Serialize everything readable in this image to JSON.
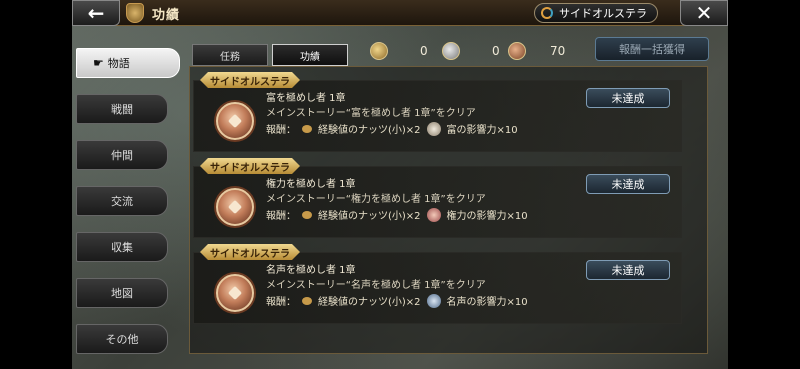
{
  "header": {
    "back_icon": "←",
    "title": "功績",
    "side_orsterra_label": "サイドオルステラ",
    "close_icon": "✕"
  },
  "nav": {
    "items": [
      {
        "label": "物語",
        "active": true
      },
      {
        "label": "戦闘"
      },
      {
        "label": "仲間"
      },
      {
        "label": "交流"
      },
      {
        "label": "収集"
      },
      {
        "label": "地図"
      },
      {
        "label": "その他"
      }
    ]
  },
  "tabs": [
    {
      "label": "任務"
    },
    {
      "label": "功績",
      "active": true
    }
  ],
  "currency": [
    {
      "type": "gold-medal-icon",
      "value": "0"
    },
    {
      "type": "silver-medal-icon",
      "value": "0"
    },
    {
      "type": "bronze-medal-icon",
      "value": "70"
    }
  ],
  "claim_all_label": "報酬一括獲得",
  "achievements": [
    {
      "tag": "サイドオルステラ",
      "name": "富を極めし者 1章",
      "description": "メインストーリー“富を極めし者 1章”をクリア",
      "reward_label": "報酬：",
      "reward1": "経験値のナッツ(小)×2",
      "reward2": "富の影響力×10",
      "status": "未達成"
    },
    {
      "tag": "サイドオルステラ",
      "name": "権力を極めし者 1章",
      "description": "メインストーリー“権力を極めし者 1章”をクリア",
      "reward_label": "報酬：",
      "reward1": "経験値のナッツ(小)×2",
      "reward2": "権力の影響力×10",
      "status": "未達成"
    },
    {
      "tag": "サイドオルステラ",
      "name": "名声を極めし者 1章",
      "description": "メインストーリー“名声を極めし者 1章”をクリア",
      "reward_label": "報酬：",
      "reward1": "経験値のナッツ(小)×2",
      "reward2": "名声の影響力×10",
      "status": "未達成"
    }
  ]
}
